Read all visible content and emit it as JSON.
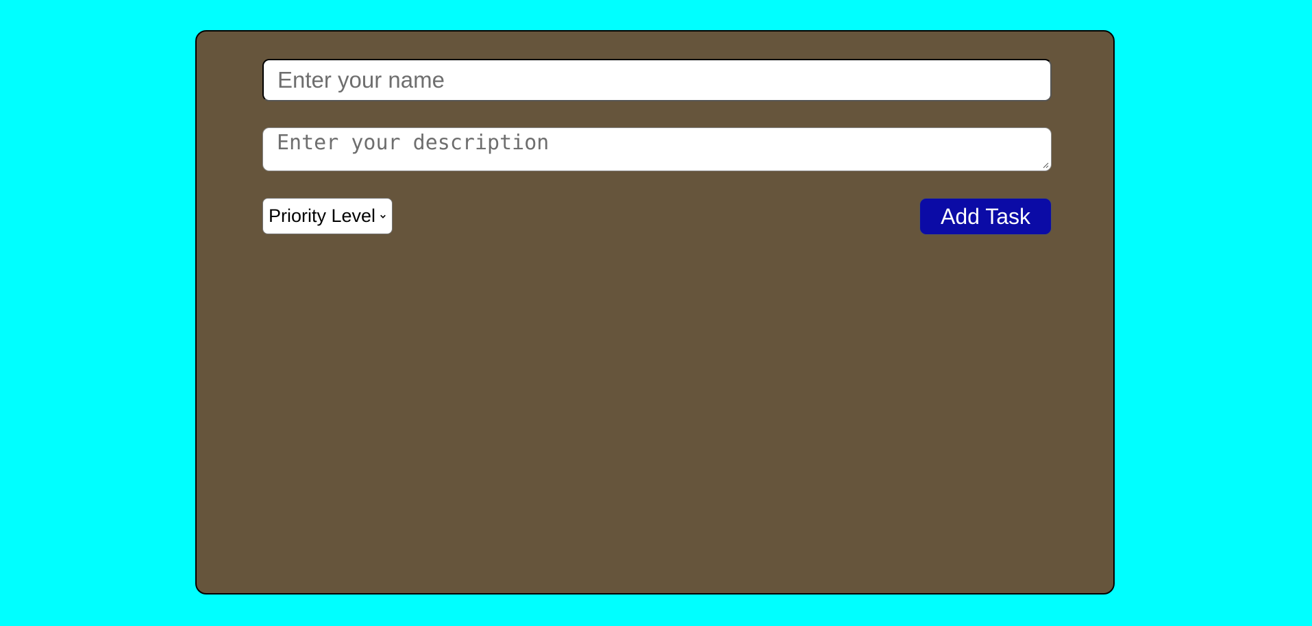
{
  "form": {
    "name_placeholder": "Enter your name",
    "name_value": "",
    "description_placeholder": "Enter your description",
    "description_value": "",
    "priority_label": "Priority Level",
    "add_button_label": "Add Task"
  },
  "icons": {
    "select_arrow": "chevron-down-icon",
    "resize": "resize-handle-icon"
  },
  "colors": {
    "page_background": "#00ffff",
    "panel_background": "#66553c",
    "button_background": "#0b0ba6",
    "button_text": "#ffffff"
  }
}
